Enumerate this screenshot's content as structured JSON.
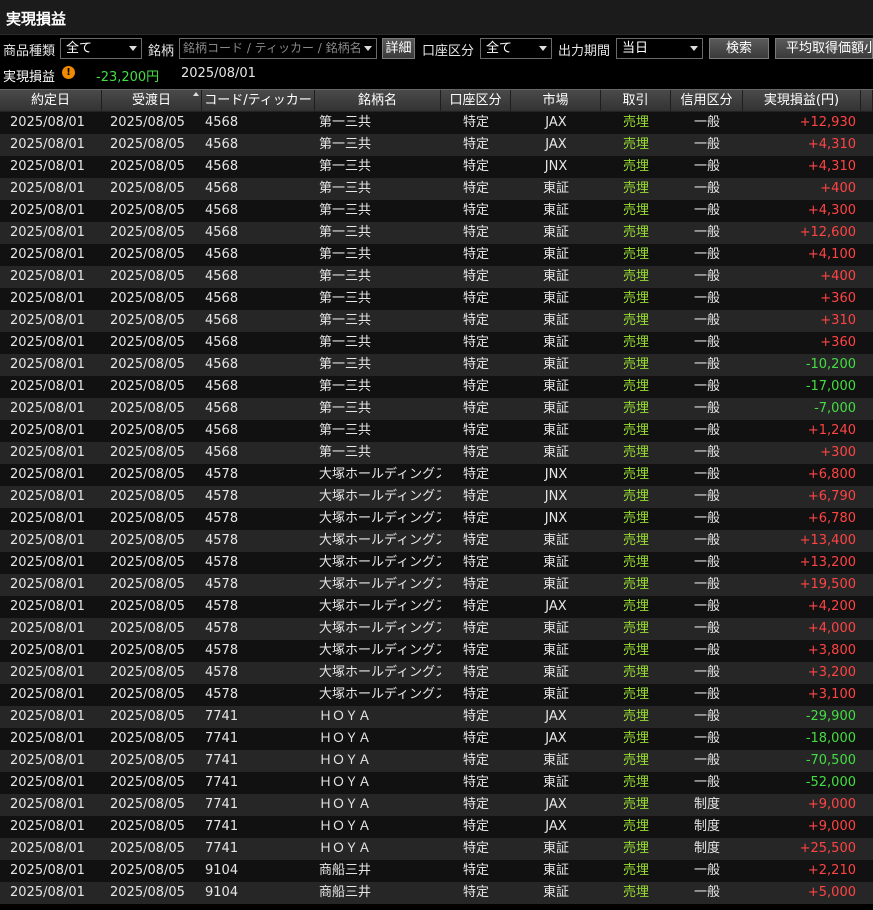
{
  "title": "実現損益",
  "filters": {
    "product_type_label": "商品種類",
    "product_type_value": "全て",
    "symbol_label": "銘柄",
    "symbol_placeholder": "銘柄コード / ティッカー / 銘柄名",
    "detail_button": "詳細",
    "account_type_label": "口座区分",
    "account_type_value": "全て",
    "period_label": "出力期間",
    "period_value": "当日",
    "search_button": "検索",
    "avg_price_button": "平均取得価額小"
  },
  "summary": {
    "label": "実現損益",
    "value": "-23,200円",
    "date": "2025/08/01"
  },
  "colors": {
    "profit": "#ff4444",
    "loss": "#44dd44",
    "trade": "#99dd33"
  },
  "table": {
    "columns": [
      "約定日",
      "受渡日",
      "コード/ティッカー",
      "銘柄名",
      "口座区分",
      "市場",
      "取引",
      "信用区分",
      "実現損益(円)"
    ],
    "rows": [
      [
        "2025/08/01",
        "2025/08/05",
        "4568",
        "第一三共",
        "特定",
        "JAX",
        "売埋",
        "一般",
        "+12,930"
      ],
      [
        "2025/08/01",
        "2025/08/05",
        "4568",
        "第一三共",
        "特定",
        "JAX",
        "売埋",
        "一般",
        "+4,310"
      ],
      [
        "2025/08/01",
        "2025/08/05",
        "4568",
        "第一三共",
        "特定",
        "JNX",
        "売埋",
        "一般",
        "+4,310"
      ],
      [
        "2025/08/01",
        "2025/08/05",
        "4568",
        "第一三共",
        "特定",
        "東証",
        "売埋",
        "一般",
        "+400"
      ],
      [
        "2025/08/01",
        "2025/08/05",
        "4568",
        "第一三共",
        "特定",
        "東証",
        "売埋",
        "一般",
        "+4,300"
      ],
      [
        "2025/08/01",
        "2025/08/05",
        "4568",
        "第一三共",
        "特定",
        "東証",
        "売埋",
        "一般",
        "+12,600"
      ],
      [
        "2025/08/01",
        "2025/08/05",
        "4568",
        "第一三共",
        "特定",
        "東証",
        "売埋",
        "一般",
        "+4,100"
      ],
      [
        "2025/08/01",
        "2025/08/05",
        "4568",
        "第一三共",
        "特定",
        "東証",
        "売埋",
        "一般",
        "+400"
      ],
      [
        "2025/08/01",
        "2025/08/05",
        "4568",
        "第一三共",
        "特定",
        "東証",
        "売埋",
        "一般",
        "+360"
      ],
      [
        "2025/08/01",
        "2025/08/05",
        "4568",
        "第一三共",
        "特定",
        "東証",
        "売埋",
        "一般",
        "+310"
      ],
      [
        "2025/08/01",
        "2025/08/05",
        "4568",
        "第一三共",
        "特定",
        "東証",
        "売埋",
        "一般",
        "+360"
      ],
      [
        "2025/08/01",
        "2025/08/05",
        "4568",
        "第一三共",
        "特定",
        "東証",
        "売埋",
        "一般",
        "-10,200"
      ],
      [
        "2025/08/01",
        "2025/08/05",
        "4568",
        "第一三共",
        "特定",
        "東証",
        "売埋",
        "一般",
        "-17,000"
      ],
      [
        "2025/08/01",
        "2025/08/05",
        "4568",
        "第一三共",
        "特定",
        "東証",
        "売埋",
        "一般",
        "-7,000"
      ],
      [
        "2025/08/01",
        "2025/08/05",
        "4568",
        "第一三共",
        "特定",
        "東証",
        "売埋",
        "一般",
        "+1,240"
      ],
      [
        "2025/08/01",
        "2025/08/05",
        "4568",
        "第一三共",
        "特定",
        "東証",
        "売埋",
        "一般",
        "+300"
      ],
      [
        "2025/08/01",
        "2025/08/05",
        "4578",
        "大塚ホールディングス",
        "特定",
        "JNX",
        "売埋",
        "一般",
        "+6,800"
      ],
      [
        "2025/08/01",
        "2025/08/05",
        "4578",
        "大塚ホールディングス",
        "特定",
        "JNX",
        "売埋",
        "一般",
        "+6,790"
      ],
      [
        "2025/08/01",
        "2025/08/05",
        "4578",
        "大塚ホールディングス",
        "特定",
        "JNX",
        "売埋",
        "一般",
        "+6,780"
      ],
      [
        "2025/08/01",
        "2025/08/05",
        "4578",
        "大塚ホールディングス",
        "特定",
        "東証",
        "売埋",
        "一般",
        "+13,400"
      ],
      [
        "2025/08/01",
        "2025/08/05",
        "4578",
        "大塚ホールディングス",
        "特定",
        "東証",
        "売埋",
        "一般",
        "+13,200"
      ],
      [
        "2025/08/01",
        "2025/08/05",
        "4578",
        "大塚ホールディングス",
        "特定",
        "東証",
        "売埋",
        "一般",
        "+19,500"
      ],
      [
        "2025/08/01",
        "2025/08/05",
        "4578",
        "大塚ホールディングス",
        "特定",
        "JAX",
        "売埋",
        "一般",
        "+4,200"
      ],
      [
        "2025/08/01",
        "2025/08/05",
        "4578",
        "大塚ホールディングス",
        "特定",
        "東証",
        "売埋",
        "一般",
        "+4,000"
      ],
      [
        "2025/08/01",
        "2025/08/05",
        "4578",
        "大塚ホールディングス",
        "特定",
        "東証",
        "売埋",
        "一般",
        "+3,800"
      ],
      [
        "2025/08/01",
        "2025/08/05",
        "4578",
        "大塚ホールディングス",
        "特定",
        "東証",
        "売埋",
        "一般",
        "+3,200"
      ],
      [
        "2025/08/01",
        "2025/08/05",
        "4578",
        "大塚ホールディングス",
        "特定",
        "東証",
        "売埋",
        "一般",
        "+3,100"
      ],
      [
        "2025/08/01",
        "2025/08/05",
        "7741",
        "ＨＯＹＡ",
        "特定",
        "JAX",
        "売埋",
        "一般",
        "-29,900"
      ],
      [
        "2025/08/01",
        "2025/08/05",
        "7741",
        "ＨＯＹＡ",
        "特定",
        "JAX",
        "売埋",
        "一般",
        "-18,000"
      ],
      [
        "2025/08/01",
        "2025/08/05",
        "7741",
        "ＨＯＹＡ",
        "特定",
        "東証",
        "売埋",
        "一般",
        "-70,500"
      ],
      [
        "2025/08/01",
        "2025/08/05",
        "7741",
        "ＨＯＹＡ",
        "特定",
        "東証",
        "売埋",
        "一般",
        "-52,000"
      ],
      [
        "2025/08/01",
        "2025/08/05",
        "7741",
        "ＨＯＹＡ",
        "特定",
        "JAX",
        "売埋",
        "制度",
        "+9,000"
      ],
      [
        "2025/08/01",
        "2025/08/05",
        "7741",
        "ＨＯＹＡ",
        "特定",
        "JAX",
        "売埋",
        "制度",
        "+9,000"
      ],
      [
        "2025/08/01",
        "2025/08/05",
        "7741",
        "ＨＯＹＡ",
        "特定",
        "東証",
        "売埋",
        "制度",
        "+25,500"
      ],
      [
        "2025/08/01",
        "2025/08/05",
        "9104",
        "商船三井",
        "特定",
        "東証",
        "売埋",
        "一般",
        "+2,210"
      ],
      [
        "2025/08/01",
        "2025/08/05",
        "9104",
        "商船三井",
        "特定",
        "東証",
        "売埋",
        "一般",
        "+5,000"
      ]
    ]
  }
}
